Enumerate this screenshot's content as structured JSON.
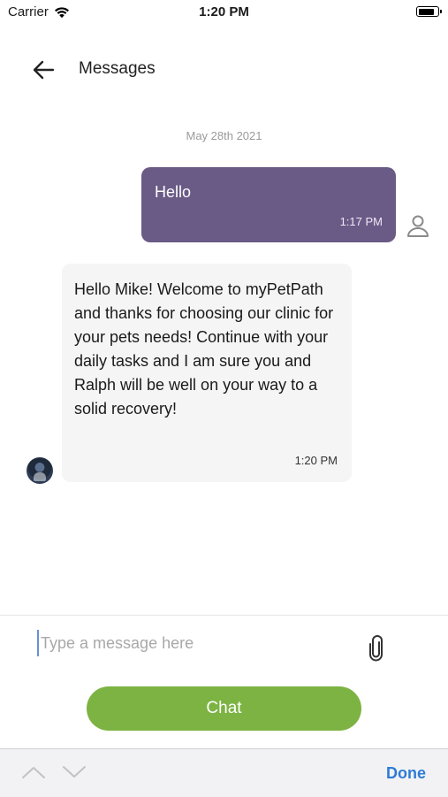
{
  "status_bar": {
    "carrier": "Carrier",
    "time": "1:20 PM",
    "battery_level": 0.85
  },
  "header": {
    "title": "Messages",
    "back_icon": "arrow-left-icon"
  },
  "conversation": {
    "date": "May 28th 2021",
    "messages": [
      {
        "direction": "outgoing",
        "text": "Hello",
        "time": "1:17 PM",
        "sender_icon": "user-outline-icon"
      },
      {
        "direction": "incoming",
        "text": "Hello Mike! Welcome to myPetPath and thanks for choosing our clinic for your pets needs! Continue with your daily tasks and I am sure you and Ralph will be well on your way to a solid recovery!",
        "time": "1:20 PM",
        "sender_icon": "avatar"
      }
    ]
  },
  "composer": {
    "placeholder": "Type a message here",
    "value": "",
    "attach_icon": "paperclip-icon",
    "chat_button_label": "Chat"
  },
  "keyboard_bar": {
    "done_label": "Done"
  },
  "colors": {
    "outgoing_bubble": "#6a5a86",
    "incoming_bubble": "#f5f5f5",
    "chat_button": "#7cb342",
    "done_link": "#2e7bd6"
  }
}
